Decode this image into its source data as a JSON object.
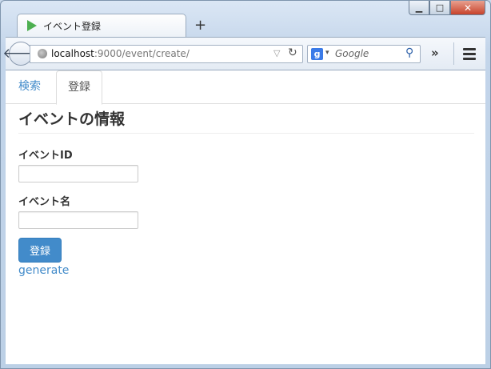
{
  "window": {
    "tab_title": "イベント登録",
    "new_tab_label": "+",
    "controls": {
      "minimize": "▁",
      "maximize": "□",
      "close": "✕"
    }
  },
  "toolbar": {
    "url_host": "localhost",
    "url_path": ":9000/event/create/",
    "search_engine": "g",
    "search_placeholder": "Google",
    "overflow_label": "»"
  },
  "page": {
    "nav_tabs": [
      {
        "label": "検索",
        "active": false
      },
      {
        "label": "登録",
        "active": true
      }
    ],
    "heading": "イベントの情報",
    "form": {
      "event_id_label": "イベントID",
      "event_id_value": "",
      "event_name_label": "イベント名",
      "event_name_value": "",
      "submit_label": "登録"
    },
    "generate_link": "generate"
  },
  "colors": {
    "link": "#428bca",
    "primary_button": "#428bca",
    "tab_icon": "#4caf50"
  }
}
